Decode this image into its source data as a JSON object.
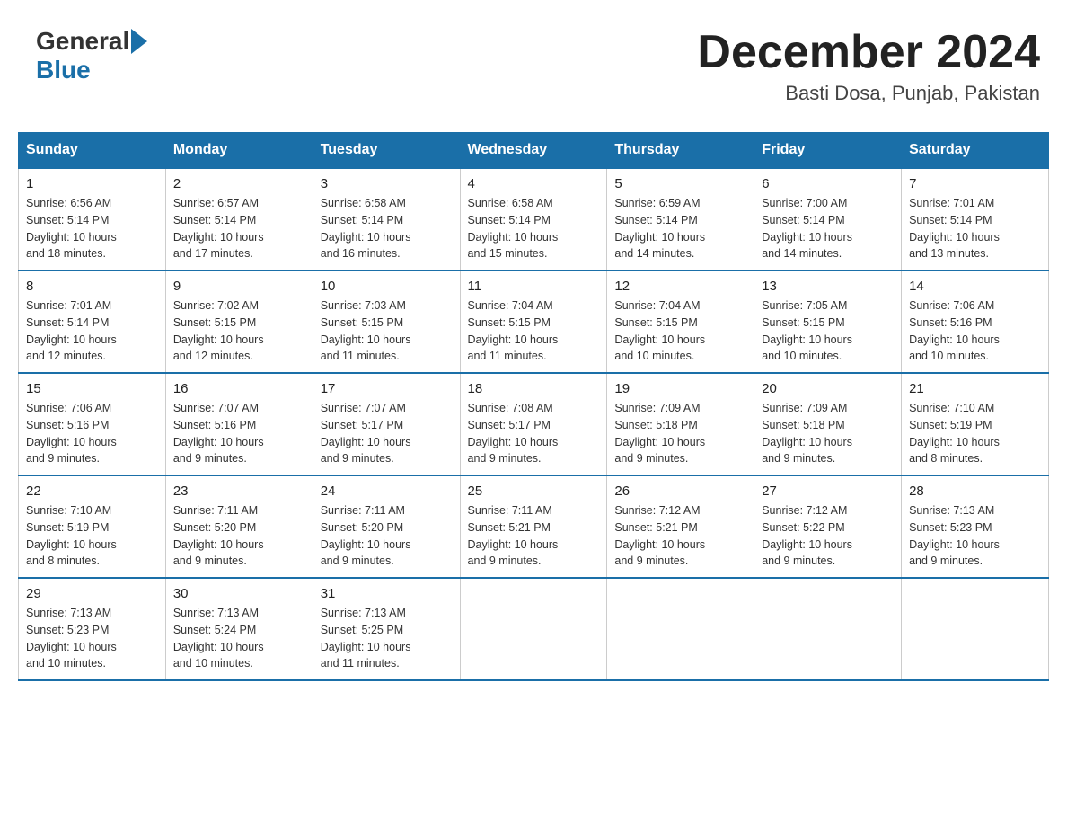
{
  "header": {
    "logo_general": "General",
    "logo_blue": "Blue",
    "month_title": "December 2024",
    "subtitle": "Basti Dosa, Punjab, Pakistan"
  },
  "days_of_week": [
    "Sunday",
    "Monday",
    "Tuesday",
    "Wednesday",
    "Thursday",
    "Friday",
    "Saturday"
  ],
  "weeks": [
    [
      {
        "num": "1",
        "sunrise": "6:56 AM",
        "sunset": "5:14 PM",
        "daylight": "10 hours and 18 minutes."
      },
      {
        "num": "2",
        "sunrise": "6:57 AM",
        "sunset": "5:14 PM",
        "daylight": "10 hours and 17 minutes."
      },
      {
        "num": "3",
        "sunrise": "6:58 AM",
        "sunset": "5:14 PM",
        "daylight": "10 hours and 16 minutes."
      },
      {
        "num": "4",
        "sunrise": "6:58 AM",
        "sunset": "5:14 PM",
        "daylight": "10 hours and 15 minutes."
      },
      {
        "num": "5",
        "sunrise": "6:59 AM",
        "sunset": "5:14 PM",
        "daylight": "10 hours and 14 minutes."
      },
      {
        "num": "6",
        "sunrise": "7:00 AM",
        "sunset": "5:14 PM",
        "daylight": "10 hours and 14 minutes."
      },
      {
        "num": "7",
        "sunrise": "7:01 AM",
        "sunset": "5:14 PM",
        "daylight": "10 hours and 13 minutes."
      }
    ],
    [
      {
        "num": "8",
        "sunrise": "7:01 AM",
        "sunset": "5:14 PM",
        "daylight": "10 hours and 12 minutes."
      },
      {
        "num": "9",
        "sunrise": "7:02 AM",
        "sunset": "5:15 PM",
        "daylight": "10 hours and 12 minutes."
      },
      {
        "num": "10",
        "sunrise": "7:03 AM",
        "sunset": "5:15 PM",
        "daylight": "10 hours and 11 minutes."
      },
      {
        "num": "11",
        "sunrise": "7:04 AM",
        "sunset": "5:15 PM",
        "daylight": "10 hours and 11 minutes."
      },
      {
        "num": "12",
        "sunrise": "7:04 AM",
        "sunset": "5:15 PM",
        "daylight": "10 hours and 10 minutes."
      },
      {
        "num": "13",
        "sunrise": "7:05 AM",
        "sunset": "5:15 PM",
        "daylight": "10 hours and 10 minutes."
      },
      {
        "num": "14",
        "sunrise": "7:06 AM",
        "sunset": "5:16 PM",
        "daylight": "10 hours and 10 minutes."
      }
    ],
    [
      {
        "num": "15",
        "sunrise": "7:06 AM",
        "sunset": "5:16 PM",
        "daylight": "10 hours and 9 minutes."
      },
      {
        "num": "16",
        "sunrise": "7:07 AM",
        "sunset": "5:16 PM",
        "daylight": "10 hours and 9 minutes."
      },
      {
        "num": "17",
        "sunrise": "7:07 AM",
        "sunset": "5:17 PM",
        "daylight": "10 hours and 9 minutes."
      },
      {
        "num": "18",
        "sunrise": "7:08 AM",
        "sunset": "5:17 PM",
        "daylight": "10 hours and 9 minutes."
      },
      {
        "num": "19",
        "sunrise": "7:09 AM",
        "sunset": "5:18 PM",
        "daylight": "10 hours and 9 minutes."
      },
      {
        "num": "20",
        "sunrise": "7:09 AM",
        "sunset": "5:18 PM",
        "daylight": "10 hours and 9 minutes."
      },
      {
        "num": "21",
        "sunrise": "7:10 AM",
        "sunset": "5:19 PM",
        "daylight": "10 hours and 8 minutes."
      }
    ],
    [
      {
        "num": "22",
        "sunrise": "7:10 AM",
        "sunset": "5:19 PM",
        "daylight": "10 hours and 8 minutes."
      },
      {
        "num": "23",
        "sunrise": "7:11 AM",
        "sunset": "5:20 PM",
        "daylight": "10 hours and 9 minutes."
      },
      {
        "num": "24",
        "sunrise": "7:11 AM",
        "sunset": "5:20 PM",
        "daylight": "10 hours and 9 minutes."
      },
      {
        "num": "25",
        "sunrise": "7:11 AM",
        "sunset": "5:21 PM",
        "daylight": "10 hours and 9 minutes."
      },
      {
        "num": "26",
        "sunrise": "7:12 AM",
        "sunset": "5:21 PM",
        "daylight": "10 hours and 9 minutes."
      },
      {
        "num": "27",
        "sunrise": "7:12 AM",
        "sunset": "5:22 PM",
        "daylight": "10 hours and 9 minutes."
      },
      {
        "num": "28",
        "sunrise": "7:13 AM",
        "sunset": "5:23 PM",
        "daylight": "10 hours and 9 minutes."
      }
    ],
    [
      {
        "num": "29",
        "sunrise": "7:13 AM",
        "sunset": "5:23 PM",
        "daylight": "10 hours and 10 minutes."
      },
      {
        "num": "30",
        "sunrise": "7:13 AM",
        "sunset": "5:24 PM",
        "daylight": "10 hours and 10 minutes."
      },
      {
        "num": "31",
        "sunrise": "7:13 AM",
        "sunset": "5:25 PM",
        "daylight": "10 hours and 11 minutes."
      },
      null,
      null,
      null,
      null
    ]
  ],
  "labels": {
    "sunrise": "Sunrise:",
    "sunset": "Sunset:",
    "daylight": "Daylight:"
  }
}
